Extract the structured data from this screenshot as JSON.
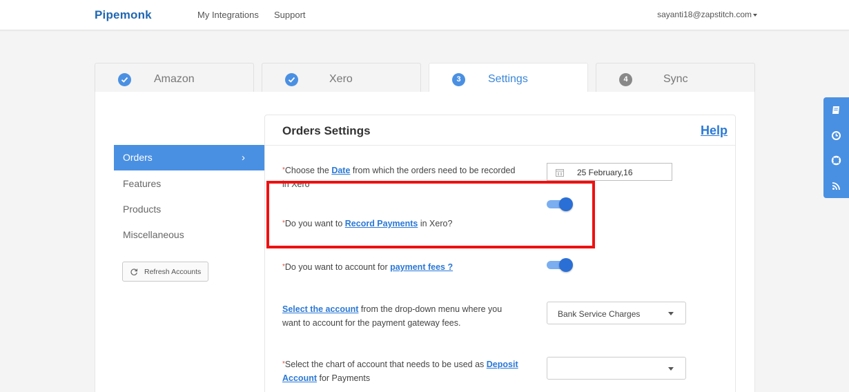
{
  "header": {
    "brand": "Pipemonk",
    "nav": [
      "My Integrations",
      "Support"
    ],
    "user_email": "sayanti18@zapstitch.com"
  },
  "steps": [
    {
      "label": "Amazon",
      "badge": "check",
      "state": "done"
    },
    {
      "label": "Xero",
      "badge": "check",
      "state": "done"
    },
    {
      "label": "Settings",
      "badge": "3",
      "state": "active"
    },
    {
      "label": "Sync",
      "badge": "4",
      "state": "pending"
    }
  ],
  "sidebar": {
    "items": [
      "Orders",
      "Features",
      "Products",
      "Miscellaneous"
    ],
    "active": "Orders",
    "refresh_label": "Refresh Accounts"
  },
  "settings": {
    "title": "Orders Settings",
    "help": "Help",
    "q_date": {
      "pre": "Choose the ",
      "link": "Date",
      "post": " from which the orders need to be recorded in Xero"
    },
    "date_value": "25 February,16",
    "q_record": {
      "pre": "Do you want to ",
      "link": "Record Payments",
      "post": " in Xero?"
    },
    "record_payments_on": true,
    "q_fees": {
      "pre": "Do you want to account for ",
      "link": "payment fees ?",
      "post": ""
    },
    "payment_fees_on": true,
    "q_account": {
      "link": "Select the account",
      "post": " from the drop-down menu where you want to account for the payment gateway fees."
    },
    "account_selected": "Bank Service Charges",
    "q_deposit": {
      "pre": "Select the chart of account that needs to be used as ",
      "link": "Deposit Account",
      "post": " for Payments"
    },
    "deposit_selected": ""
  },
  "colors": {
    "accent": "#4a90e2",
    "link": "#2a78d6",
    "highlight": "#ee1111",
    "required": "#e34b3b"
  },
  "right_toolbar": [
    "book-icon",
    "clock-icon",
    "lifebuoy-icon",
    "rss-icon"
  ]
}
